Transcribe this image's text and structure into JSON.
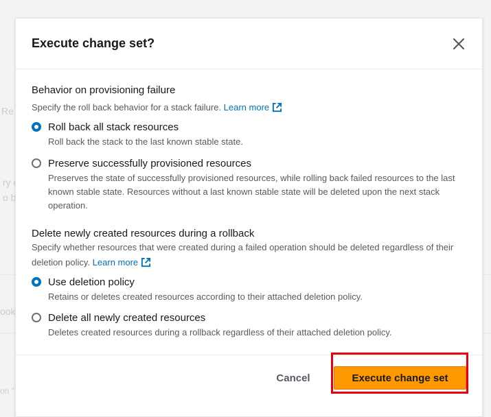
{
  "modal": {
    "title": "Execute change set?"
  },
  "provisioning": {
    "title": "Behavior on provisioning failure",
    "description": "Specify the roll back behavior for a stack failure.",
    "learn_more": "Learn more",
    "options": [
      {
        "label": "Roll back all stack resources",
        "description": "Roll back the stack to the last known stable state.",
        "checked": true
      },
      {
        "label": "Preserve successfully provisioned resources",
        "description": "Preserves the state of successfully provisioned resources, while rolling back failed resources to the last known stable state. Resources without a last known stable state will be deleted upon the next stack operation.",
        "checked": false
      }
    ]
  },
  "rollback": {
    "title": "Delete newly created resources during a rollback",
    "description": "Specify whether resources that were created during a failed operation should be deleted regardless of their deletion policy.",
    "learn_more": "Learn more",
    "options": [
      {
        "label": "Use deletion policy",
        "description": "Retains or deletes created resources according to their attached deletion policy.",
        "checked": true
      },
      {
        "label": "Delete all newly created resources",
        "description": "Deletes created resources during a rollback regardless of their attached deletion policy.",
        "checked": false
      }
    ]
  },
  "footer": {
    "cancel_label": "Cancel",
    "execute_label": "Execute change set"
  },
  "colors": {
    "primary_button": "#ff9900",
    "link": "#0073bb",
    "highlight": "#e8000b"
  }
}
